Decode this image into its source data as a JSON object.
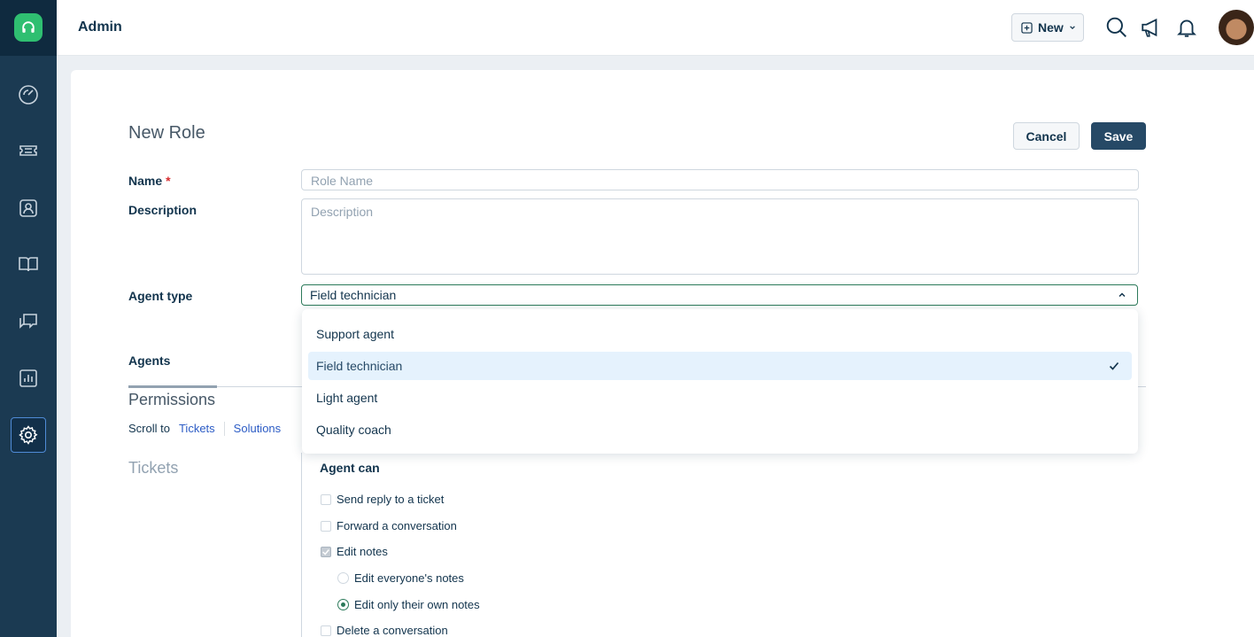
{
  "header": {
    "title": "Admin",
    "new_button": "New"
  },
  "sidebar": {
    "items": [
      {
        "icon": "dashboard-icon"
      },
      {
        "icon": "tickets-icon"
      },
      {
        "icon": "contacts-icon"
      },
      {
        "icon": "solutions-book-icon"
      },
      {
        "icon": "conversations-icon"
      },
      {
        "icon": "reports-icon"
      },
      {
        "icon": "settings-gear-icon",
        "active": true
      }
    ]
  },
  "form": {
    "page_title": "New Role",
    "cancel_label": "Cancel",
    "save_label": "Save",
    "name_label": "Name",
    "name_required": "*",
    "name_placeholder": "Role Name",
    "description_label": "Description",
    "description_placeholder": "Description",
    "agent_type_label": "Agent type",
    "agent_type_value": "Field technician",
    "agents_label": "Agents"
  },
  "dropdown": {
    "options": [
      "Support agent",
      "Field technician",
      "Light agent",
      "Quality coach"
    ],
    "selected": "Field technician"
  },
  "permissions": {
    "title": "Permissions",
    "scroll_to_label": "Scroll to",
    "scroll_links": [
      "Tickets",
      "Solutions"
    ],
    "section_title": "Tickets",
    "agent_can_label": "Agent can",
    "items": [
      {
        "label": "Send reply to a ticket",
        "type": "checkbox",
        "checked": false
      },
      {
        "label": "Forward a conversation",
        "type": "checkbox",
        "checked": false
      },
      {
        "label": "Edit notes",
        "type": "checkbox",
        "checked": true
      },
      {
        "label": "Edit everyone's notes",
        "type": "radio",
        "checked": false
      },
      {
        "label": "Edit only their own notes",
        "type": "radio",
        "checked": true
      },
      {
        "label": "Delete a conversation",
        "type": "checkbox",
        "checked": false
      }
    ]
  },
  "colors": {
    "sidebar": "#1b3a52",
    "brand_green": "#2fbf71",
    "primary_button": "#264966",
    "link": "#2c5cc5",
    "selected_option_bg": "#e5f2fd"
  }
}
